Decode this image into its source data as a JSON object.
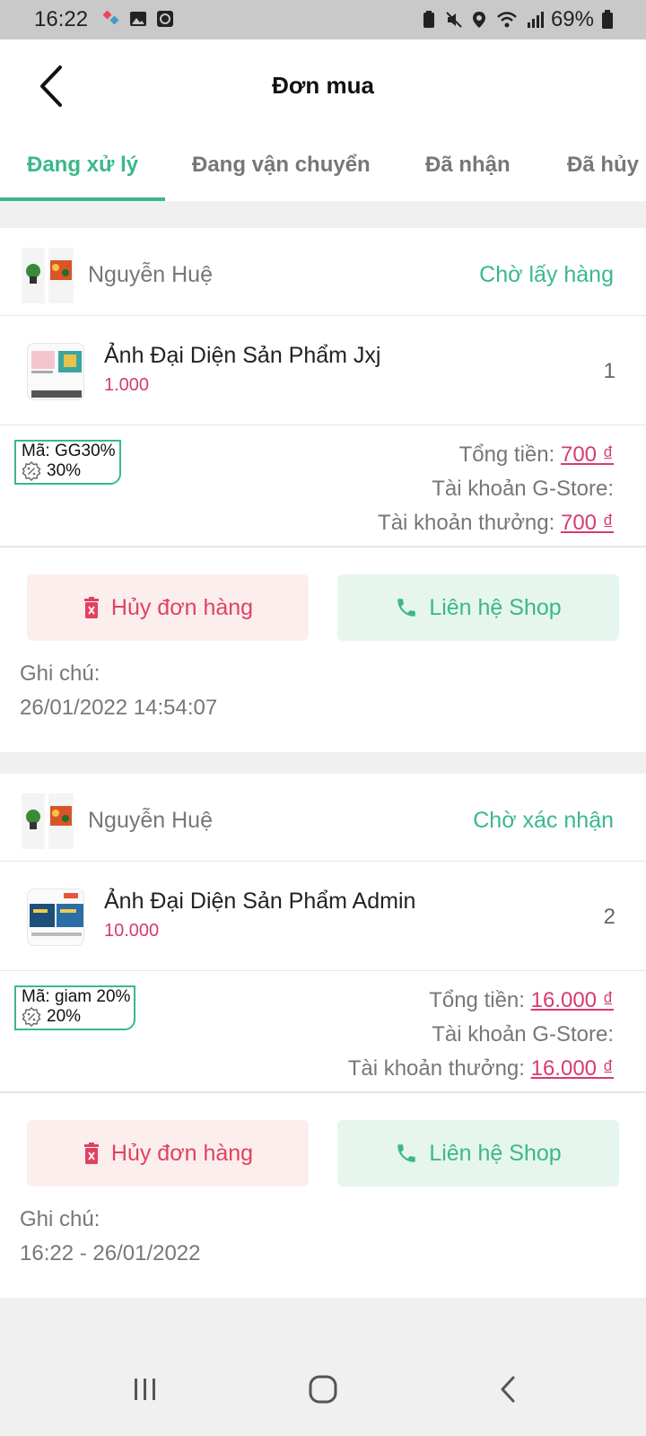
{
  "status_bar": {
    "time": "16:22",
    "battery": "69%"
  },
  "header": {
    "title": "Đơn mua"
  },
  "tabs": [
    {
      "label": "Đang xử lý",
      "active": true
    },
    {
      "label": "Đang vận chuyển",
      "active": false
    },
    {
      "label": "Đã nhận",
      "active": false
    },
    {
      "label": "Đã hủy",
      "active": false
    }
  ],
  "orders": [
    {
      "shop_name": "Nguyễn Huệ",
      "status": "Chờ lấy hàng",
      "product_name": "Ảnh Đại Diện Sản Phẩm Jxj",
      "product_price": "1.000",
      "quantity": "1",
      "coupon_code": "Mã: GG30%",
      "coupon_percent": "30%",
      "total_label": "Tổng tiền:",
      "total_value": "700 ₫",
      "gstore_label": "Tài khoản G-Store:",
      "bonus_label": "Tài khoản thưởng:",
      "bonus_value": "700 ₫",
      "cancel_label": "Hủy đơn hàng",
      "contact_label": "Liên hệ Shop",
      "note_label": "Ghi chú:",
      "note_value": "26/01/2022 14:54:07"
    },
    {
      "shop_name": "Nguyễn Huệ",
      "status": "Chờ xác nhận",
      "product_name": "Ảnh Đại Diện Sản Phẩm Admin",
      "product_price": "10.000",
      "quantity": "2",
      "coupon_code": "Mã: giam 20%",
      "coupon_percent": "20%",
      "total_label": "Tổng tiền:",
      "total_value": "16.000 ₫",
      "gstore_label": "Tài khoản G-Store:",
      "bonus_label": "Tài khoản thưởng:",
      "bonus_value": "16.000 ₫",
      "cancel_label": "Hủy đơn hàng",
      "contact_label": "Liên hệ Shop",
      "note_label": "Ghi chú:",
      "note_value": "16:22 - 26/01/2022"
    }
  ],
  "colors": {
    "accent": "#3bb88a",
    "price": "#d63c6c",
    "cancel": "#e04260"
  }
}
